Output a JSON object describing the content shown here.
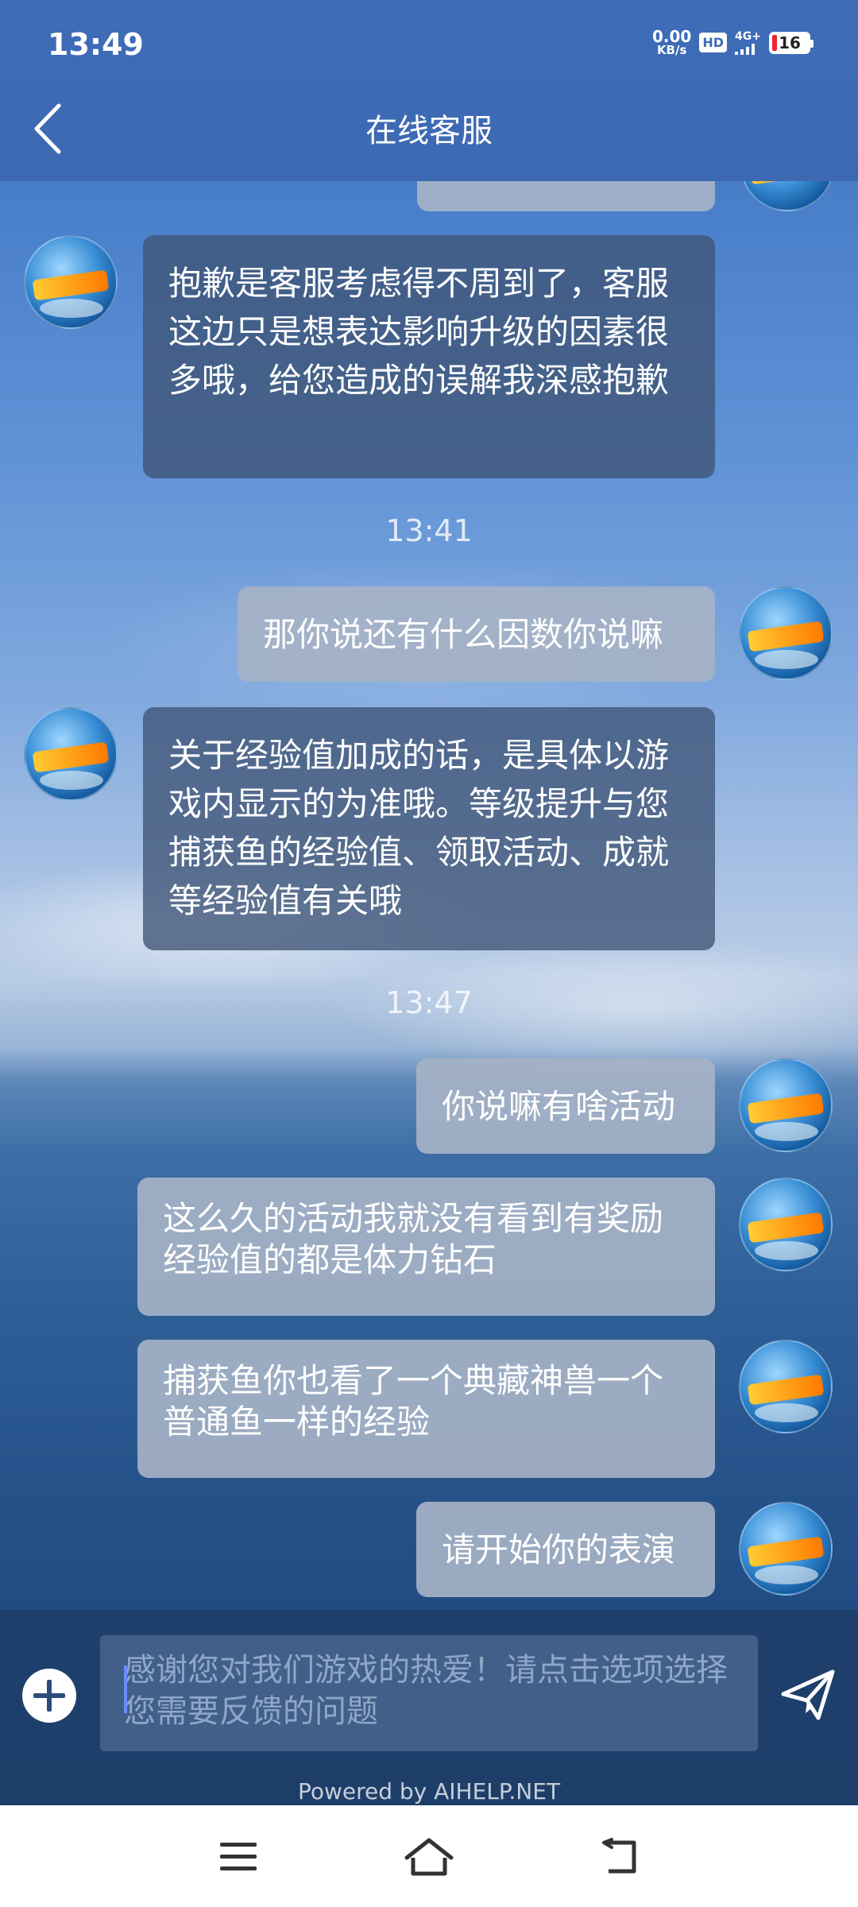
{
  "status_bar": {
    "time": "13:49",
    "net_speed_value": "0.00",
    "net_speed_unit": "KB/s",
    "hd": "HD",
    "signal": "4G+",
    "battery": "16"
  },
  "header": {
    "title": "在线客服",
    "back_icon": "chevron-left-icon"
  },
  "chat": {
    "messages": [
      {
        "from": "agent",
        "text": "抱歉是客服考虑得不周到了，客服这边只是想表达影响升级的因素很多哦，给您造成的误解我深感抱歉"
      },
      {
        "type": "timestamp",
        "text": "13:41"
      },
      {
        "from": "user",
        "text": "那你说还有什么因数你说嘛"
      },
      {
        "from": "agent",
        "text": "关于经验值加成的话，是具体以游戏内显示的为准哦。等级提升与您捕获鱼的经验值、领取活动、成就等经验值有关哦"
      },
      {
        "type": "timestamp",
        "text": "13:47"
      },
      {
        "from": "user",
        "text": "你说嘛有啥活动"
      },
      {
        "from": "user",
        "text": "这么久的活动我就没有看到有奖励经验值的都是体力钻石"
      },
      {
        "from": "user",
        "text": "捕获鱼你也看了一个典藏神兽一个普通鱼一样的经验"
      },
      {
        "from": "user",
        "text": "请开始你的表演"
      }
    ]
  },
  "input": {
    "placeholder": "感谢您对我们游戏的热爱！请点击选项选择您需要反馈的问题",
    "add_icon": "plus-circle-icon",
    "send_icon": "send-icon"
  },
  "footer": {
    "powered_by": "Powered by AIHELP.NET"
  },
  "nav": {
    "items": [
      "menu-icon",
      "home-icon",
      "back-icon"
    ]
  },
  "colors": {
    "header": "#3e6cb7",
    "agent_bubble": "#3f5476",
    "user_bubble": "#a5b2c6"
  }
}
